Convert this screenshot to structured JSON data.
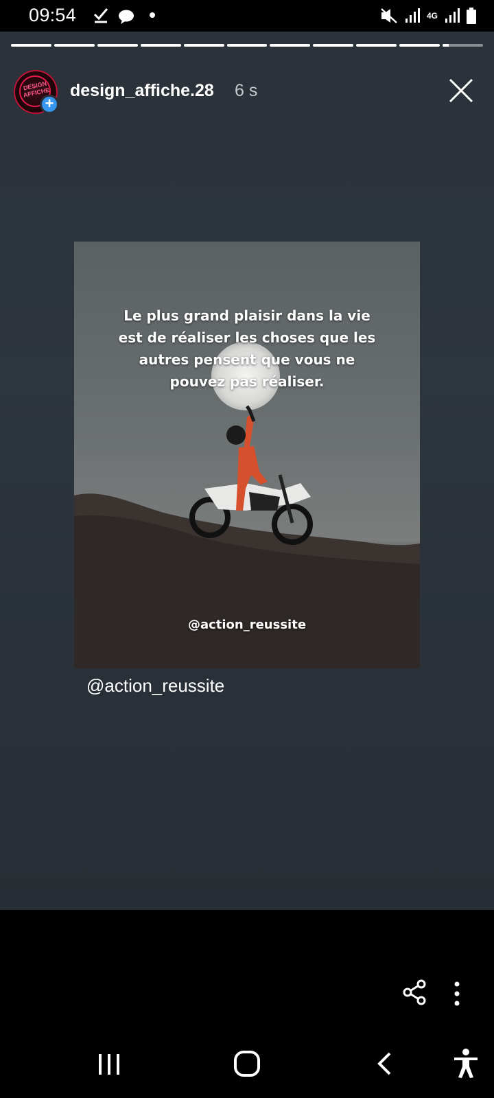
{
  "status_bar": {
    "time": "09:54",
    "network": "4G",
    "icons": [
      "download-check-icon",
      "chat-bubble-icon",
      "notification-dot-icon",
      "mute-icon",
      "signal-icon",
      "signal-icon",
      "battery-icon"
    ]
  },
  "story": {
    "segments_total": 11,
    "segments_viewed": 10,
    "current_segment_progress": 0.15,
    "username": "design_affiche.28",
    "time_ago": "6 s",
    "avatar_text": "DESIGN AFFICHE",
    "post": {
      "quote_lines": [
        "Le plus grand plaisir dans la vie",
        "est de réaliser les choses que les",
        "autres pensent que vous ne",
        "pouvez pas réaliser."
      ],
      "image_tag": "@action_reussite"
    },
    "mention": "@action_reussite"
  },
  "colors": {
    "accent": "#3897f0",
    "avatar_ring": "#e21b4d",
    "background": "#2b323a"
  }
}
